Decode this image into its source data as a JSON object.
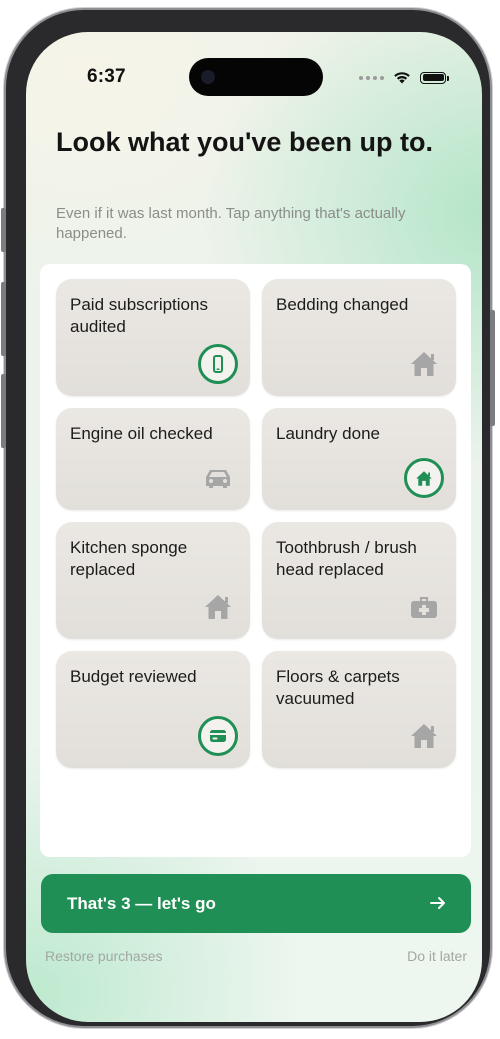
{
  "status_bar": {
    "time": "6:37"
  },
  "header": {
    "title": "Look what you've been up to.",
    "subtitle": "Even if it was last month. Tap anything that's actually happened."
  },
  "tiles": [
    {
      "label": "Paid subscriptions audited",
      "icon": "phone-icon",
      "selected": true
    },
    {
      "label": "Bedding changed",
      "icon": "house-icon",
      "selected": false
    },
    {
      "label": "Engine oil checked",
      "icon": "car-icon",
      "selected": false
    },
    {
      "label": "Laundry done",
      "icon": "house-icon",
      "selected": true
    },
    {
      "label": "Kitchen sponge replaced",
      "icon": "house-icon",
      "selected": false
    },
    {
      "label": "Toothbrush / brush head replaced",
      "icon": "medkit-icon",
      "selected": false
    },
    {
      "label": "Budget reviewed",
      "icon": "card-icon",
      "selected": true
    },
    {
      "label": "Floors & carpets vacuumed",
      "icon": "house-icon",
      "selected": false
    }
  ],
  "cta": {
    "label": "That's 3 — let's go"
  },
  "footer": {
    "restore_label": "Restore purchases",
    "later_label": "Do it later"
  },
  "colors": {
    "accent": "#1f8f55",
    "tile_bg": "#e6e3de",
    "icon_muted": "#a6a6a6"
  }
}
